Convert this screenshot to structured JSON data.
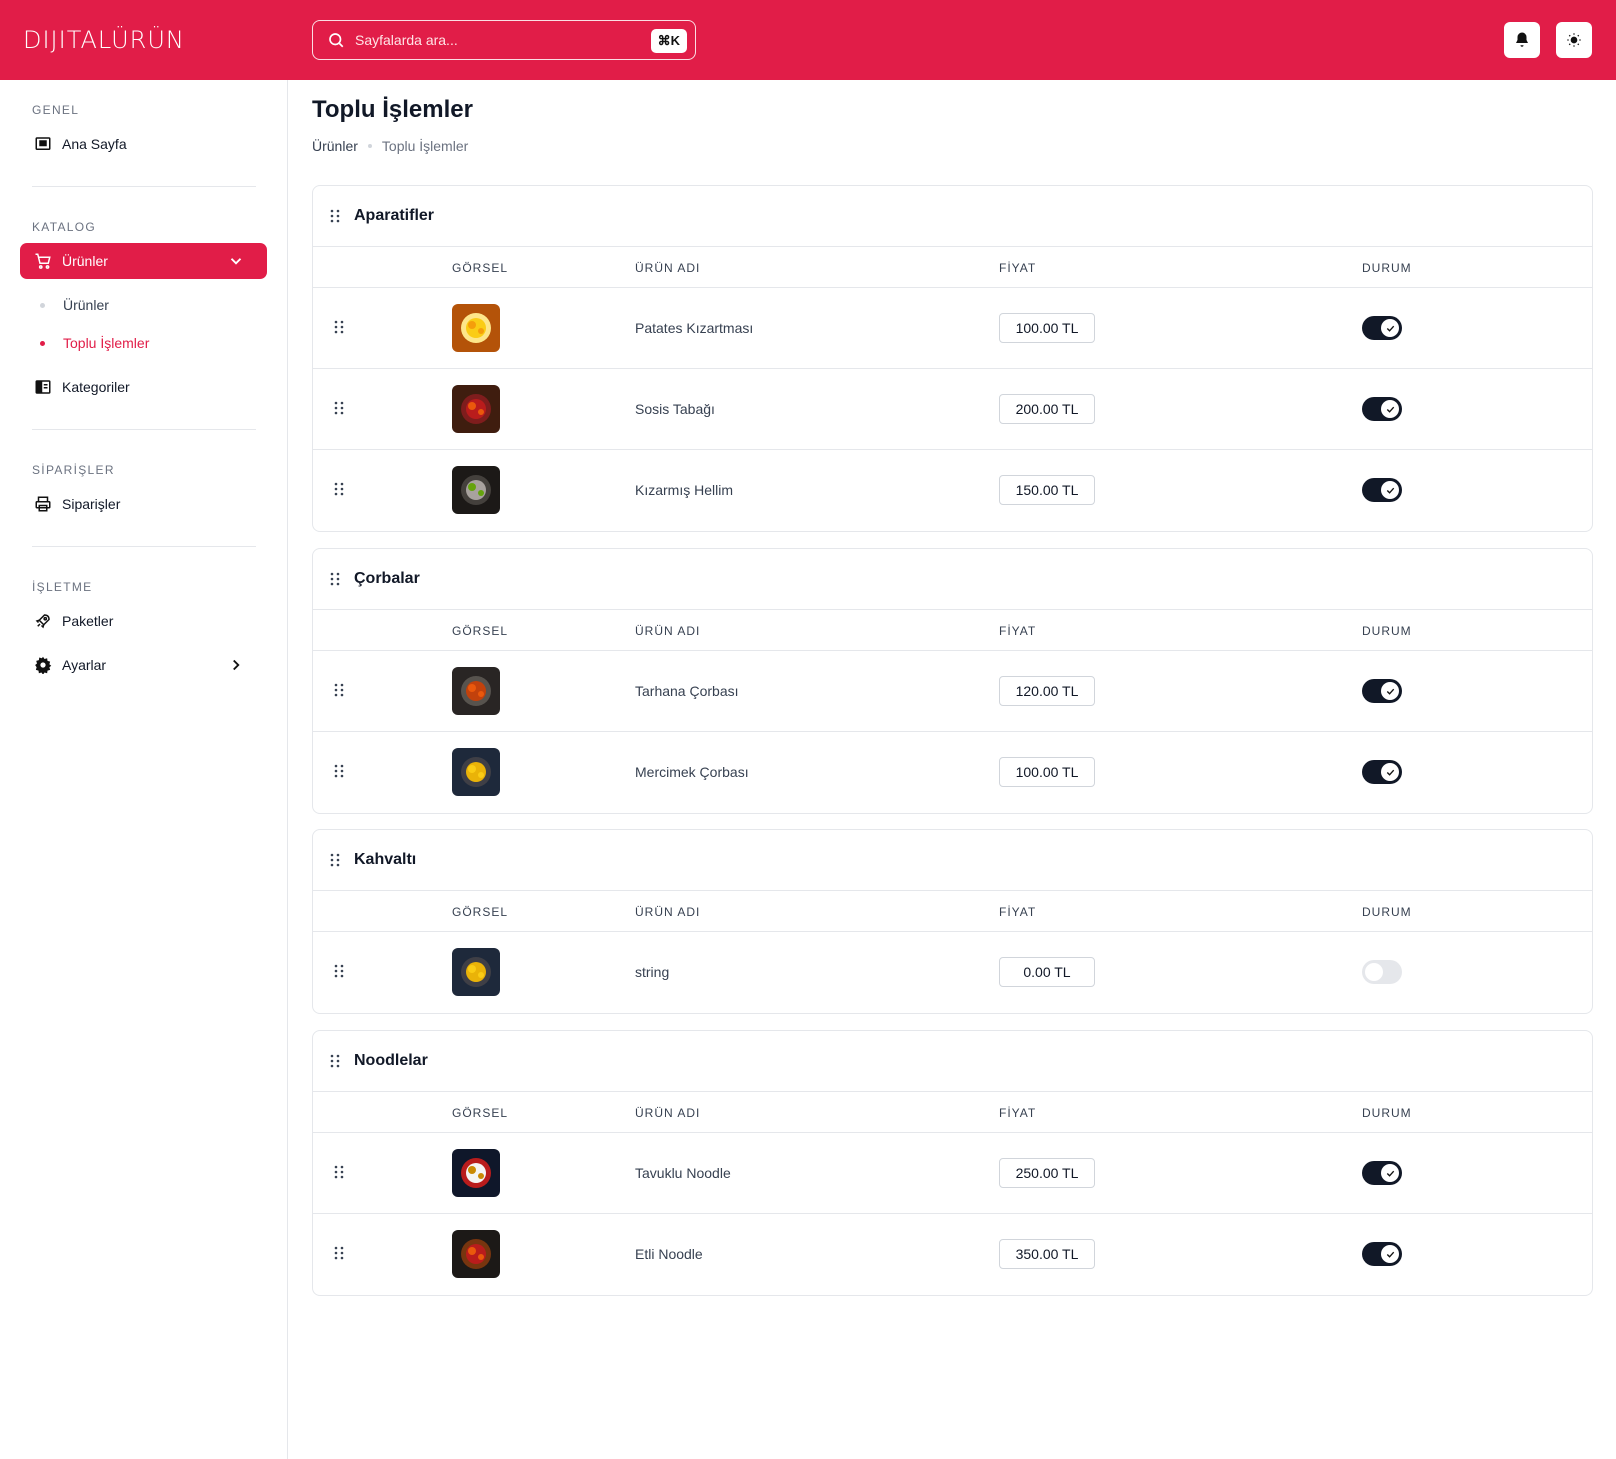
{
  "app": {
    "logo": "DIJITALÜRÜN",
    "brand_color": "#e11d48"
  },
  "search": {
    "placeholder": "Sayfalarda ara...",
    "shortcut": "⌘K"
  },
  "sidebar": {
    "genel_title": "GENEL",
    "ana_sayfa": "Ana Sayfa",
    "katalog_title": "KATALOG",
    "urunler": "Ürünler",
    "sub_urunler": "Ürünler",
    "sub_toplu": "Toplu İşlemler",
    "kategoriler": "Kategoriler",
    "siparisler_title": "SİPARİŞLER",
    "siparisler": "Siparişler",
    "isletme_title": "İŞLETME",
    "paketler": "Paketler",
    "ayarlar": "Ayarlar"
  },
  "page": {
    "title": "Toplu İşlemler",
    "breadcrumb": [
      "Ürünler",
      "Toplu İşlemler"
    ]
  },
  "table_headers": {
    "gorsel": "GÖRSEL",
    "urun_adi": "ÜRÜN ADI",
    "fiyat": "FİYAT",
    "durum": "DURUM"
  },
  "categories": [
    {
      "name": "Aparatifler",
      "products": [
        {
          "name": "Patates Kızartması",
          "price": "100.00 TL",
          "active": true,
          "image": "fries"
        },
        {
          "name": "Sosis Tabağı",
          "price": "200.00 TL",
          "active": true,
          "image": "sausage"
        },
        {
          "name": "Kızarmış Hellim",
          "price": "150.00 TL",
          "active": true,
          "image": "hellim"
        }
      ]
    },
    {
      "name": "Çorbalar",
      "products": [
        {
          "name": "Tarhana Çorbası",
          "price": "120.00 TL",
          "active": true,
          "image": "soup-red"
        },
        {
          "name": "Mercimek Çorbası",
          "price": "100.00 TL",
          "active": true,
          "image": "soup-yellow"
        }
      ]
    },
    {
      "name": "Kahvaltı",
      "products": [
        {
          "name": "string",
          "price": "0.00 TL",
          "active": false,
          "image": "soup-yellow"
        }
      ]
    },
    {
      "name": "Noodlelar",
      "products": [
        {
          "name": "Tavuklu Noodle",
          "price": "250.00 TL",
          "active": true,
          "image": "noodle-chicken"
        },
        {
          "name": "Etli Noodle",
          "price": "350.00 TL",
          "active": true,
          "image": "noodle-meat"
        }
      ]
    }
  ]
}
